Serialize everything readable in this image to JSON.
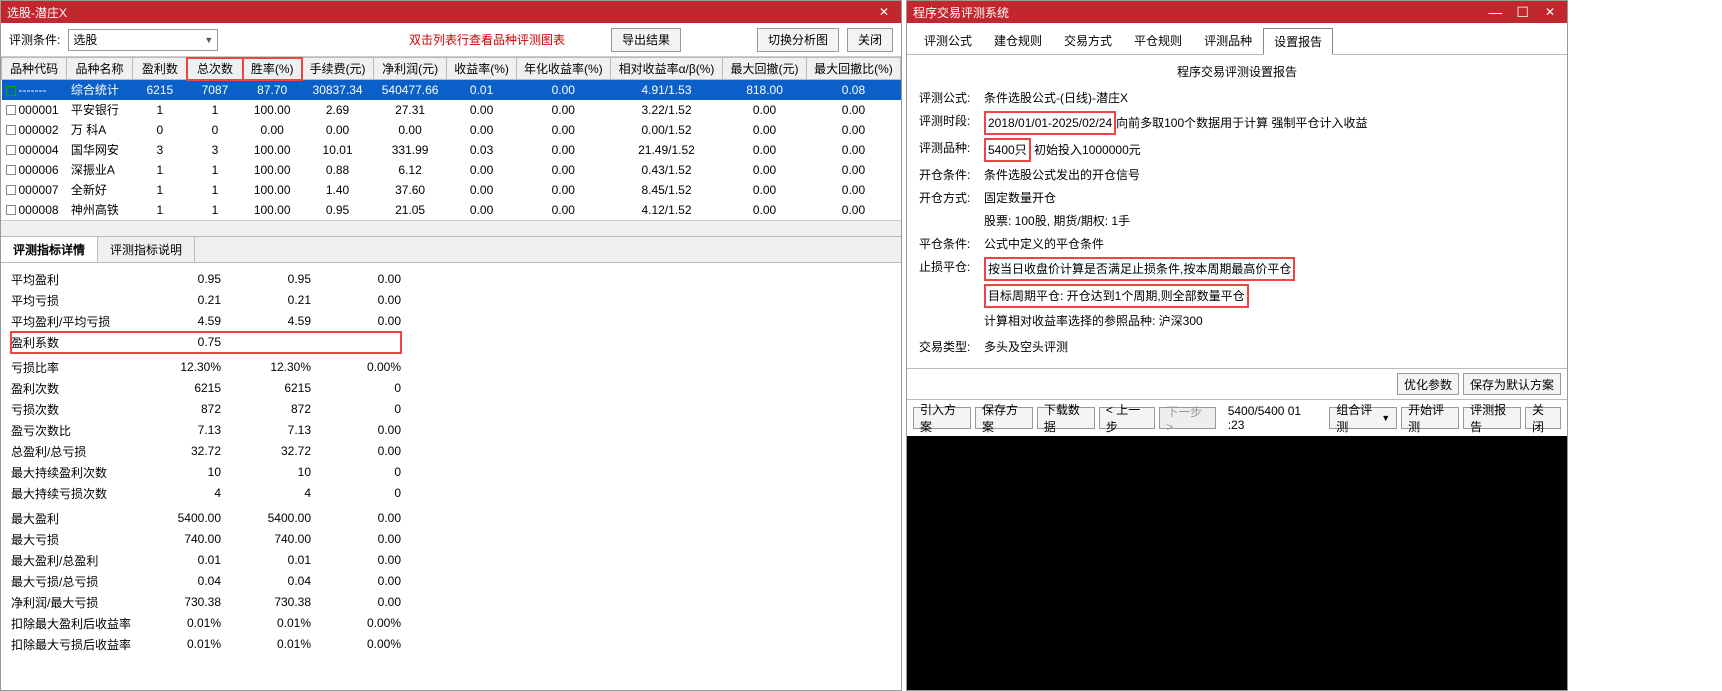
{
  "left": {
    "title": "选股-潜庄X",
    "toolbar": {
      "cond_label": "评测条件:",
      "select_value": "选股",
      "hint": "双击列表行查看品种评测图表",
      "export": "导出结果",
      "switch": "切换分析图",
      "close": "关闭"
    },
    "table": {
      "headers": [
        "品种代码",
        "品种名称",
        "盈利数",
        "总次数",
        "胜率(%)",
        "手续费(元)",
        "净利润(元)",
        "收益率(%)",
        "年化收益率(%)",
        "相对收益率α/β(%)",
        "最大回撤(元)",
        "最大回撤比(%)"
      ],
      "hl_cols": [
        3,
        4
      ],
      "rows": [
        {
          "sel": true,
          "code": "-------",
          "cells": [
            "-------",
            "综合统计",
            "6215",
            "7087",
            "87.70",
            "30837.34",
            "540477.66",
            "0.01",
            "0.00",
            "4.91/1.53",
            "818.00",
            "0.08"
          ]
        },
        {
          "code": "000001",
          "cells": [
            "000001",
            "平安银行",
            "1",
            "1",
            "100.00",
            "2.69",
            "27.31",
            "0.00",
            "0.00",
            "3.22/1.52",
            "0.00",
            "0.00"
          ]
        },
        {
          "code": "000002",
          "cells": [
            "000002",
            "万 科A",
            "0",
            "0",
            "0.00",
            "0.00",
            "0.00",
            "0.00",
            "0.00",
            "0.00/1.52",
            "0.00",
            "0.00"
          ]
        },
        {
          "code": "000004",
          "cells": [
            "000004",
            "国华网安",
            "3",
            "3",
            "100.00",
            "10.01",
            "331.99",
            "0.03",
            "0.00",
            "21.49/1.52",
            "0.00",
            "0.00"
          ]
        },
        {
          "code": "000006",
          "cells": [
            "000006",
            "深振业A",
            "1",
            "1",
            "100.00",
            "0.88",
            "6.12",
            "0.00",
            "0.00",
            "0.43/1.52",
            "0.00",
            "0.00"
          ]
        },
        {
          "code": "000007",
          "cells": [
            "000007",
            "全新好",
            "1",
            "1",
            "100.00",
            "1.40",
            "37.60",
            "0.00",
            "0.00",
            "8.45/1.52",
            "0.00",
            "0.00"
          ]
        },
        {
          "code": "000008",
          "cells": [
            "000008",
            "神州高铁",
            "1",
            "1",
            "100.00",
            "0.95",
            "21.05",
            "0.00",
            "0.00",
            "4.12/1.52",
            "0.00",
            "0.00"
          ]
        }
      ]
    },
    "tabs": {
      "t1": "评测指标详情",
      "t2": "评测指标说明"
    },
    "metrics_cols": [
      "",
      "",
      "",
      ""
    ],
    "metrics": [
      {
        "l": "平均盈利",
        "a": "0.95",
        "b": "0.95",
        "c": "0.00"
      },
      {
        "l": "平均亏损",
        "a": "0.21",
        "b": "0.21",
        "c": "0.00"
      },
      {
        "l": "平均盈利/平均亏损",
        "a": "4.59",
        "b": "4.59",
        "c": "0.00"
      },
      {
        "l": "盈利系数",
        "a": "0.75",
        "b": "",
        "c": "",
        "hl": true
      },
      {
        "l": "",
        "a": "",
        "b": "",
        "c": ""
      },
      {
        "l": "亏损比率",
        "a": "12.30%",
        "b": "12.30%",
        "c": "0.00%"
      },
      {
        "l": "盈利次数",
        "a": "6215",
        "b": "6215",
        "c": "0"
      },
      {
        "l": "亏损次数",
        "a": "872",
        "b": "872",
        "c": "0"
      },
      {
        "l": "盈亏次数比",
        "a": "7.13",
        "b": "7.13",
        "c": "0.00"
      },
      {
        "l": "总盈利/总亏损",
        "a": "32.72",
        "b": "32.72",
        "c": "0.00"
      },
      {
        "l": "最大持续盈利次数",
        "a": "10",
        "b": "10",
        "c": "0"
      },
      {
        "l": "最大持续亏损次数",
        "a": "4",
        "b": "4",
        "c": "0"
      },
      {
        "l": "",
        "a": "",
        "b": "",
        "c": ""
      },
      {
        "l": "最大盈利",
        "a": "5400.00",
        "b": "5400.00",
        "c": "0.00"
      },
      {
        "l": "最大亏损",
        "a": "740.00",
        "b": "740.00",
        "c": "0.00"
      },
      {
        "l": "最大盈利/总盈利",
        "a": "0.01",
        "b": "0.01",
        "c": "0.00"
      },
      {
        "l": "最大亏损/总亏损",
        "a": "0.04",
        "b": "0.04",
        "c": "0.00"
      },
      {
        "l": "净利润/最大亏损",
        "a": "730.38",
        "b": "730.38",
        "c": "0.00"
      },
      {
        "l": "扣除最大盈利后收益率",
        "a": "0.01%",
        "b": "0.01%",
        "c": "0.00%"
      },
      {
        "l": "扣除最大亏损后收益率",
        "a": "0.01%",
        "b": "0.01%",
        "c": "0.00%"
      }
    ]
  },
  "right": {
    "title": "程序交易评测系统",
    "tabs": [
      "评测公式",
      "建仓规则",
      "交易方式",
      "平仓规则",
      "评测品种",
      "设置报告"
    ],
    "active_tab": 5,
    "report": {
      "title": "程序交易评测设置报告",
      "lines": [
        {
          "lbl": "评测公式:",
          "parts": [
            {
              "t": "条件选股公式-(日线)-潜庄X"
            }
          ]
        },
        {
          "lbl": "评测时段:",
          "parts": [
            {
              "t": "2018/01/01-2025/02/24",
              "hl": true
            },
            {
              "t": "向前多取100个数据用于计算 强制平仓计入收益"
            }
          ]
        },
        {
          "lbl": "评测品种:",
          "parts": [
            {
              "t": "5400只",
              "hl": true
            },
            {
              "t": " 初始投入1000000元"
            }
          ]
        },
        {
          "lbl": "开仓条件:",
          "parts": [
            {
              "t": "条件选股公式发出的开仓信号"
            }
          ]
        },
        {
          "lbl": "开仓方式:",
          "parts": [
            {
              "t": "固定数量开仓"
            }
          ]
        },
        {
          "lbl": "",
          "parts": [
            {
              "t": "股票: 100股, 期货/期权: 1手"
            }
          ]
        },
        {
          "lbl": "平仓条件:",
          "parts": [
            {
              "t": "公式中定义的平仓条件"
            }
          ]
        },
        {
          "lbl": "止损平仓:",
          "parts": [
            {
              "t": "按当日收盘价计算是否满足止损条件,按本周期最高价平仓",
              "hl": true
            }
          ]
        },
        {
          "lbl": "",
          "parts": [
            {
              "t": "目标周期平仓: 开仓达到1个周期,则全部数量平仓",
              "hl": true
            }
          ]
        },
        {
          "lbl": "",
          "parts": [
            {
              "t": "计算相对收益率选择的参照品种: 沪深300"
            }
          ]
        },
        {
          "lbl": "",
          "parts": [
            {
              "t": ""
            }
          ]
        },
        {
          "lbl": "交易类型:",
          "parts": [
            {
              "t": "多头及空头评测"
            }
          ]
        }
      ]
    },
    "bar1": {
      "opt": "优化参数",
      "save_def": "保存为默认方案"
    },
    "bar2": {
      "import": "引入方案",
      "save": "保存方案",
      "dl": "下载数据",
      "prev": "< 上一步",
      "next": "下一步 >",
      "status": "5400/5400  01 :23",
      "combo": "组合评测",
      "start": "开始评测",
      "report": "评测报告",
      "close": "关闭"
    }
  }
}
